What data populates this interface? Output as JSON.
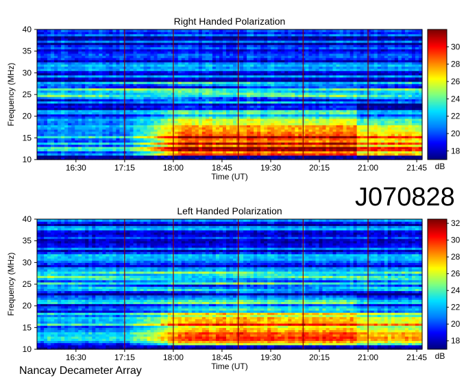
{
  "header": {
    "id_label": "J070828"
  },
  "footer": {
    "instrument": "Nancay Decameter Array"
  },
  "colors": {
    "cmap": [
      "#00007f",
      "#0000ff",
      "#0080ff",
      "#00e0ff",
      "#7fff7f",
      "#ffff00",
      "#ff8000",
      "#ff0000",
      "#7f0000"
    ],
    "markers": "#8b0000"
  },
  "chart_data": [
    {
      "type": "heatmap",
      "title": "Right Handed Polarization",
      "xlabel": "Time (UT)",
      "ylabel": "Frequency (MHz)",
      "x_ticks": [
        "16:30",
        "17:15",
        "18:00",
        "18:45",
        "19:30",
        "20:15",
        "21:00",
        "21:45"
      ],
      "x_tick_minutes": [
        990,
        1035,
        1080,
        1125,
        1170,
        1215,
        1260,
        1305
      ],
      "xlim_minutes": [
        954,
        1310
      ],
      "y_ticks": [
        10,
        15,
        20,
        25,
        30,
        35,
        40
      ],
      "ylim": [
        10,
        40
      ],
      "colorbar": {
        "label": "dB",
        "ticks": [
          18,
          20,
          22,
          24,
          26,
          28,
          30
        ],
        "range": [
          17,
          32
        ]
      },
      "markers": [
        "17:15",
        "18:00",
        "19:00",
        "20:00",
        "21:00"
      ],
      "grid": false
    },
    {
      "type": "heatmap",
      "title": "Left Handed Polarization",
      "xlabel": "Time (UT)",
      "ylabel": "Frequency (MHz)",
      "x_ticks": [
        "16:30",
        "17:15",
        "18:00",
        "18:45",
        "19:30",
        "20:15",
        "21:00",
        "21:45"
      ],
      "x_tick_minutes": [
        990,
        1035,
        1080,
        1125,
        1170,
        1215,
        1260,
        1305
      ],
      "xlim_minutes": [
        954,
        1310
      ],
      "y_ticks": [
        10,
        15,
        20,
        25,
        30,
        35,
        40
      ],
      "ylim": [
        10,
        40
      ],
      "colorbar": {
        "label": "dB",
        "ticks": [
          18,
          20,
          22,
          24,
          26,
          28,
          30,
          32
        ],
        "range": [
          17,
          32.5
        ]
      },
      "markers": [
        "17:15",
        "18:00",
        "19:00",
        "20:00",
        "21:00"
      ],
      "grid": false
    }
  ]
}
